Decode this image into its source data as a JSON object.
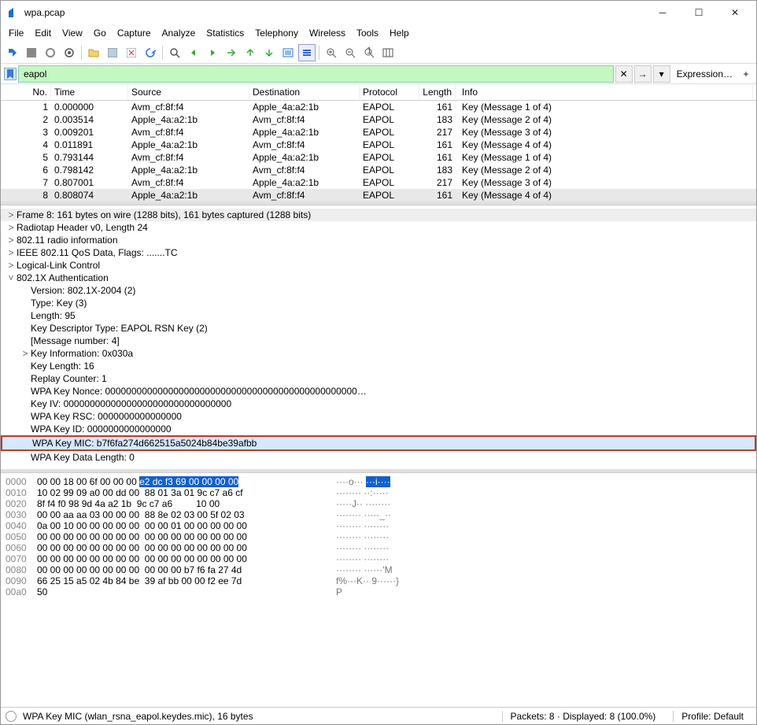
{
  "window": {
    "title": "wpa.pcap"
  },
  "menu": {
    "items": [
      "File",
      "Edit",
      "View",
      "Go",
      "Capture",
      "Analyze",
      "Statistics",
      "Telephony",
      "Wireless",
      "Tools",
      "Help"
    ]
  },
  "filter": {
    "value": "eapol",
    "expression": "Expression…"
  },
  "packet_list": {
    "headers": [
      "No.",
      "Time",
      "Source",
      "Destination",
      "Protocol",
      "Length",
      "Info"
    ],
    "rows": [
      {
        "no": "1",
        "time": "0.000000",
        "src": "Avm_cf:8f:f4",
        "dst": "Apple_4a:a2:1b",
        "proto": "EAPOL",
        "len": "161",
        "info": "Key (Message 1 of 4)"
      },
      {
        "no": "2",
        "time": "0.003514",
        "src": "Apple_4a:a2:1b",
        "dst": "Avm_cf:8f:f4",
        "proto": "EAPOL",
        "len": "183",
        "info": "Key (Message 2 of 4)"
      },
      {
        "no": "3",
        "time": "0.009201",
        "src": "Avm_cf:8f:f4",
        "dst": "Apple_4a:a2:1b",
        "proto": "EAPOL",
        "len": "217",
        "info": "Key (Message 3 of 4)"
      },
      {
        "no": "4",
        "time": "0.011891",
        "src": "Apple_4a:a2:1b",
        "dst": "Avm_cf:8f:f4",
        "proto": "EAPOL",
        "len": "161",
        "info": "Key (Message 4 of 4)"
      },
      {
        "no": "5",
        "time": "0.793144",
        "src": "Avm_cf:8f:f4",
        "dst": "Apple_4a:a2:1b",
        "proto": "EAPOL",
        "len": "161",
        "info": "Key (Message 1 of 4)"
      },
      {
        "no": "6",
        "time": "0.798142",
        "src": "Apple_4a:a2:1b",
        "dst": "Avm_cf:8f:f4",
        "proto": "EAPOL",
        "len": "183",
        "info": "Key (Message 2 of 4)"
      },
      {
        "no": "7",
        "time": "0.807001",
        "src": "Avm_cf:8f:f4",
        "dst": "Apple_4a:a2:1b",
        "proto": "EAPOL",
        "len": "217",
        "info": "Key (Message 3 of 4)"
      },
      {
        "no": "8",
        "time": "0.808074",
        "src": "Apple_4a:a2:1b",
        "dst": "Avm_cf:8f:f4",
        "proto": "EAPOL",
        "len": "161",
        "info": "Key (Message 4 of 4)",
        "selected": true
      }
    ]
  },
  "details": [
    {
      "t": "Frame 8: 161 bytes on wire (1288 bits), 161 bytes captured (1288 bits)",
      "exp": ">",
      "sel": true
    },
    {
      "t": "Radiotap Header v0, Length 24",
      "exp": ">"
    },
    {
      "t": "802.11 radio information",
      "exp": ">"
    },
    {
      "t": "IEEE 802.11 QoS Data, Flags: .......TC",
      "exp": ">"
    },
    {
      "t": "Logical-Link Control",
      "exp": ">"
    },
    {
      "t": "802.1X Authentication",
      "exp": "v"
    },
    {
      "t": "Version: 802.1X-2004 (2)",
      "ind": 1
    },
    {
      "t": "Type: Key (3)",
      "ind": 1
    },
    {
      "t": "Length: 95",
      "ind": 1
    },
    {
      "t": "Key Descriptor Type: EAPOL RSN Key (2)",
      "ind": 1
    },
    {
      "t": "[Message number: 4]",
      "ind": 1
    },
    {
      "t": "Key Information: 0x030a",
      "ind": 1,
      "exp": ">"
    },
    {
      "t": "Key Length: 16",
      "ind": 1
    },
    {
      "t": "Replay Counter: 1",
      "ind": 1
    },
    {
      "t": "WPA Key Nonce: 000000000000000000000000000000000000000000000000…",
      "ind": 1
    },
    {
      "t": "Key IV: 00000000000000000000000000000000",
      "ind": 1
    },
    {
      "t": "WPA Key RSC: 0000000000000000",
      "ind": 1
    },
    {
      "t": "WPA Key ID: 0000000000000000",
      "ind": 1
    },
    {
      "t": "WPA Key MIC: b7f6fa274d662515a5024b84be39afbb",
      "ind": 1,
      "hl": true
    },
    {
      "t": "WPA Key Data Length: 0",
      "ind": 1
    }
  ],
  "hex": [
    {
      "o": "0000",
      "b": "00 00 18 00 6f 00 00 00 ",
      "b2": "e2 dc f3 69 00 00 00 00",
      "a": "····o··· ",
      "a2": "···i····",
      "hl": true
    },
    {
      "o": "0010",
      "b": "10 02 99 09 a0 00 dd 00  88 01 3a 01 9c c7 a6 cf",
      "a": "········ ··:·····"
    },
    {
      "o": "0020",
      "b": "8f f4 f0 98 9d 4a a2 1b  9c c7 a6         10 00",
      "a": "·····J·· ········"
    },
    {
      "o": "0030",
      "b": "00 00 aa aa 03 00 00 00  88 8e 02 03 00 5f 02 03",
      "a": "········ ·····_··"
    },
    {
      "o": "0040",
      "b": "0a 00 10 00 00 00 00 00  00 00 01 00 00 00 00 00",
      "a": "········ ········"
    },
    {
      "o": "0050",
      "b": "00 00 00 00 00 00 00 00  00 00 00 00 00 00 00 00",
      "a": "········ ········"
    },
    {
      "o": "0060",
      "b": "00 00 00 00 00 00 00 00  00 00 00 00 00 00 00 00",
      "a": "········ ········"
    },
    {
      "o": "0070",
      "b": "00 00 00 00 00 00 00 00  00 00 00 00 00 00 00 00",
      "a": "········ ········"
    },
    {
      "o": "0080",
      "b": "00 00 00 00 00 00 00 00  00 00 00 b7 f6 fa 27 4d",
      "a": "········ ······'M"
    },
    {
      "o": "0090",
      "b": "66 25 15 a5 02 4b 84 be  39 af bb 00 00 f2 ee 7d",
      "a": "f%···K·· 9······}"
    },
    {
      "o": "00a0",
      "b": "50",
      "a": "P"
    }
  ],
  "status": {
    "field": "WPA Key MIC (wlan_rsna_eapol.keydes.mic), 16 bytes",
    "packets": "Packets: 8 · Displayed: 8 (100.0%)",
    "profile": "Profile: Default"
  }
}
